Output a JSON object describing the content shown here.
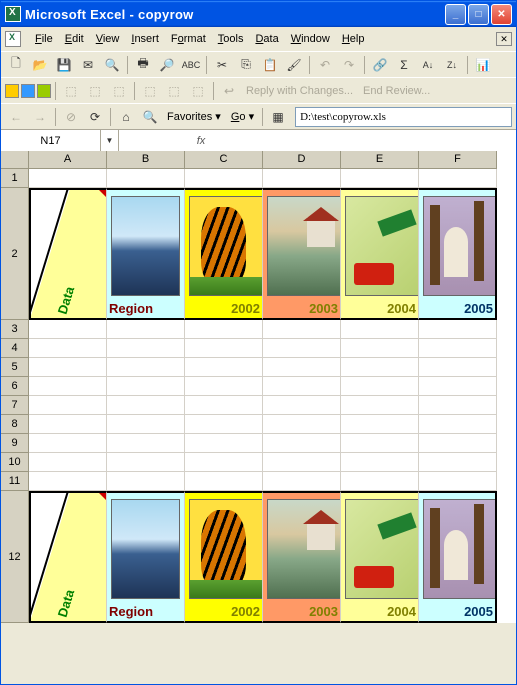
{
  "titlebar": {
    "text": "Microsoft Excel - copyrow"
  },
  "menus": {
    "file": "File",
    "edit": "Edit",
    "view": "View",
    "insert": "Insert",
    "format": "Format",
    "tools": "Tools",
    "data": "Data",
    "window": "Window",
    "help": "Help"
  },
  "nav": {
    "favorites": "Favorites",
    "go": "Go",
    "path": "D:\\test\\copyrow.xls"
  },
  "review": {
    "reply": "Reply with Changes...",
    "end": "End Review..."
  },
  "namebox": "N17",
  "fx": "fx",
  "col_headers": {
    "A": "A",
    "B": "B",
    "C": "C",
    "D": "D",
    "E": "E",
    "F": "F"
  },
  "row_headers": [
    "1",
    "2",
    "3",
    "4",
    "5",
    "6",
    "7",
    "8",
    "9",
    "10",
    "11",
    "12"
  ],
  "chart_data": {
    "type": "table",
    "header_cell": "Data",
    "columns": [
      "Region",
      2002,
      2003,
      2004,
      2005
    ],
    "images": [
      "mountain",
      "tiger",
      "house",
      "tractor",
      "church"
    ]
  }
}
